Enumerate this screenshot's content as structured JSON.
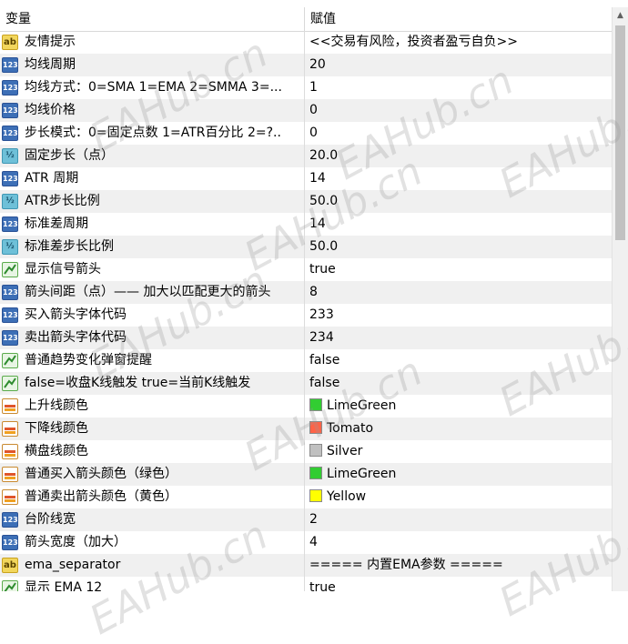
{
  "header": {
    "variable_label": "变量",
    "value_label": "赋值"
  },
  "rows": [
    {
      "type": "str",
      "icon": "string-icon",
      "name": "友情提示",
      "value": "<<交易有风险，投资者盈亏自负>>"
    },
    {
      "type": "int",
      "icon": "integer-icon",
      "name": "均线周期",
      "value": "20"
    },
    {
      "type": "int",
      "icon": "integer-icon",
      "name": "均线方式：0=SMA 1=EMA 2=SMMA 3=...",
      "value": "1"
    },
    {
      "type": "int",
      "icon": "integer-icon",
      "name": "均线价格",
      "value": "0"
    },
    {
      "type": "int",
      "icon": "integer-icon",
      "name": "步长模式：0=固定点数 1=ATR百分比 2=?..",
      "value": "0"
    },
    {
      "type": "dbl",
      "icon": "double-icon",
      "name": "固定步长（点）",
      "value": "20.0"
    },
    {
      "type": "int",
      "icon": "integer-icon",
      "name": "ATR 周期",
      "value": "14"
    },
    {
      "type": "dbl",
      "icon": "double-icon",
      "name": "ATR步长比例",
      "value": "50.0"
    },
    {
      "type": "int",
      "icon": "integer-icon",
      "name": "标准差周期",
      "value": "14"
    },
    {
      "type": "dbl",
      "icon": "double-icon",
      "name": "标准差步长比例",
      "value": "50.0"
    },
    {
      "type": "bool",
      "icon": "boolean-icon",
      "name": "显示信号箭头",
      "value": "true"
    },
    {
      "type": "int",
      "icon": "integer-icon",
      "name": "箭头间距（点）—— 加大以匹配更大的箭头",
      "value": "8"
    },
    {
      "type": "int",
      "icon": "integer-icon",
      "name": "买入箭头字体代码",
      "value": "233"
    },
    {
      "type": "int",
      "icon": "integer-icon",
      "name": "卖出箭头字体代码",
      "value": "234"
    },
    {
      "type": "bool",
      "icon": "boolean-icon",
      "name": "普通趋势变化弹窗提醒",
      "value": "false"
    },
    {
      "type": "bool",
      "icon": "boolean-icon",
      "name": "false=收盘K线触发 true=当前K线触发",
      "value": "false"
    },
    {
      "type": "clr",
      "icon": "color-icon",
      "name": "上升线颜色",
      "value": "LimeGreen",
      "swatch": "#32cd32"
    },
    {
      "type": "clr",
      "icon": "color-icon",
      "name": "下降线颜色",
      "value": "Tomato",
      "swatch": "#ff6347"
    },
    {
      "type": "clr",
      "icon": "color-icon",
      "name": "横盘线颜色",
      "value": "Silver",
      "swatch": "#c0c0c0"
    },
    {
      "type": "clr",
      "icon": "color-icon",
      "name": "普通买入箭头颜色（绿色）",
      "value": "LimeGreen",
      "swatch": "#32cd32"
    },
    {
      "type": "clr",
      "icon": "color-icon",
      "name": "普通卖出箭头颜色（黄色）",
      "value": "Yellow",
      "swatch": "#ffff00"
    },
    {
      "type": "int",
      "icon": "integer-icon",
      "name": "台阶线宽",
      "value": "2"
    },
    {
      "type": "int",
      "icon": "integer-icon",
      "name": "箭头宽度（加大）",
      "value": "4"
    },
    {
      "type": "str",
      "icon": "string-icon",
      "name": "ema_separator",
      "value": "===== 内置EMA参数 ====="
    },
    {
      "type": "bool",
      "icon": "boolean-icon",
      "name": "显示 EMA 12",
      "value": "true"
    }
  ],
  "watermark": "EAHub.cn",
  "icon_text": {
    "int": "123",
    "dbl": "½",
    "str": "ab"
  }
}
